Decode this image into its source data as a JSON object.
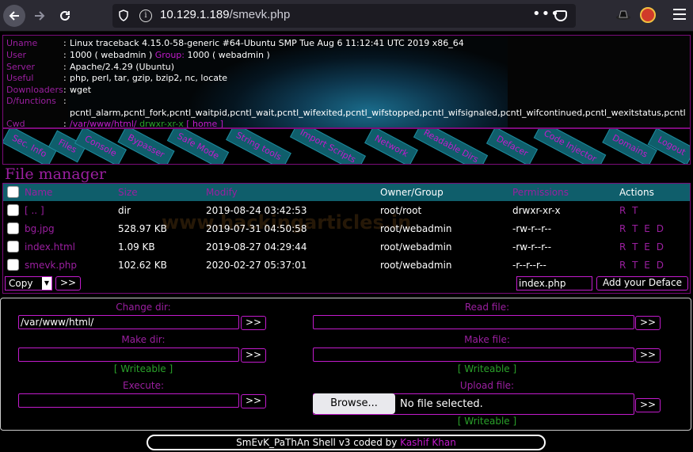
{
  "browser": {
    "url_host": "10.129.1.189",
    "url_path": "/smevk.php",
    "dots": "•••"
  },
  "info": {
    "rows": [
      {
        "key": "Uname",
        "value": "Linux traceback 4.15.0-58-generic #64-Ubuntu SMP Tue Aug 6 11:12:41 UTC 2019 x86_64"
      },
      {
        "key": "User",
        "value": "1000 ( webadmin ) ",
        "pink": "Group:",
        "value2": " 1000 ( webadmin )"
      },
      {
        "key": "Server",
        "value": "Apache/2.4.29 (Ubuntu)"
      },
      {
        "key": "Useful",
        "value": "php, perl, tar, gzip, bzip2, nc, locate"
      },
      {
        "key": "Downloaders",
        "value": "wget"
      },
      {
        "key": "D/functions",
        "value": ""
      },
      {
        "key": "",
        "value": "pcntl_alarm,pcntl_fork,pcntl_waitpid,pcntl_wait,pcntl_wifexited,pcntl_wifstopped,pcntl_wifsignaled,pcntl_wifcontinued,pcntl_wexitstatus,pcntl"
      },
      {
        "key": "Cwd",
        "value": "/var/www/html/",
        "green": "drwxr-xr-x",
        "home": "[ home ]"
      }
    ]
  },
  "menu": [
    "Sec. Info",
    "Files",
    "Console",
    "Bypasser",
    "Safe Mode",
    "String tools",
    "Import Scripts",
    "Network",
    "Readable Dirs",
    "Defacer",
    "Code Injector",
    "Domains",
    "Logout"
  ],
  "file_manager": {
    "title": "File manager",
    "headers": [
      "Name",
      "Size",
      "Modify",
      "Owner/Group",
      "Permissions",
      "Actions"
    ],
    "rows": [
      {
        "name": "[ .. ]",
        "size": "dir",
        "modify": "2019-08-24 03:42:53",
        "owner": "root/root",
        "perms": "drwxr-xr-x",
        "actions": "R T"
      },
      {
        "name": "bg.jpg",
        "size": "528.97 KB",
        "modify": "2019-07-31 04:50:58",
        "owner": "root/webadmin",
        "perms": "-rw-r--r--",
        "actions": "R T E D"
      },
      {
        "name": "index.html",
        "size": "1.09 KB",
        "modify": "2019-08-27 04:29:44",
        "owner": "root/webadmin",
        "perms": "-rw-r--r--",
        "actions": "R T E D"
      },
      {
        "name": "smevk.php",
        "size": "102.62 KB",
        "modify": "2020-02-27 05:37:01",
        "owner": "root/webadmin",
        "perms": "-r--r--r--",
        "actions": "R T E D"
      }
    ],
    "watermark": "www.hackingarticles.in",
    "copy_label": "Copy",
    "go_label": ">>",
    "deface_value": "index.php",
    "deface_button": "Add your Deface"
  },
  "tools": {
    "change_dir": "Change dir:",
    "change_dir_value": "/var/www/html/",
    "read_file": "Read file:",
    "make_dir": "Make dir:",
    "make_file": "Make file:",
    "writeable": "[ Writeable ]",
    "execute": "Execute:",
    "upload_file": "Upload file:",
    "browse": "Browse...",
    "no_file": "No file selected.",
    "go": ">>"
  },
  "footer": {
    "text": "SmEvK_PaThAn Shell v3 coded by ",
    "author": "Kashif Khan"
  }
}
